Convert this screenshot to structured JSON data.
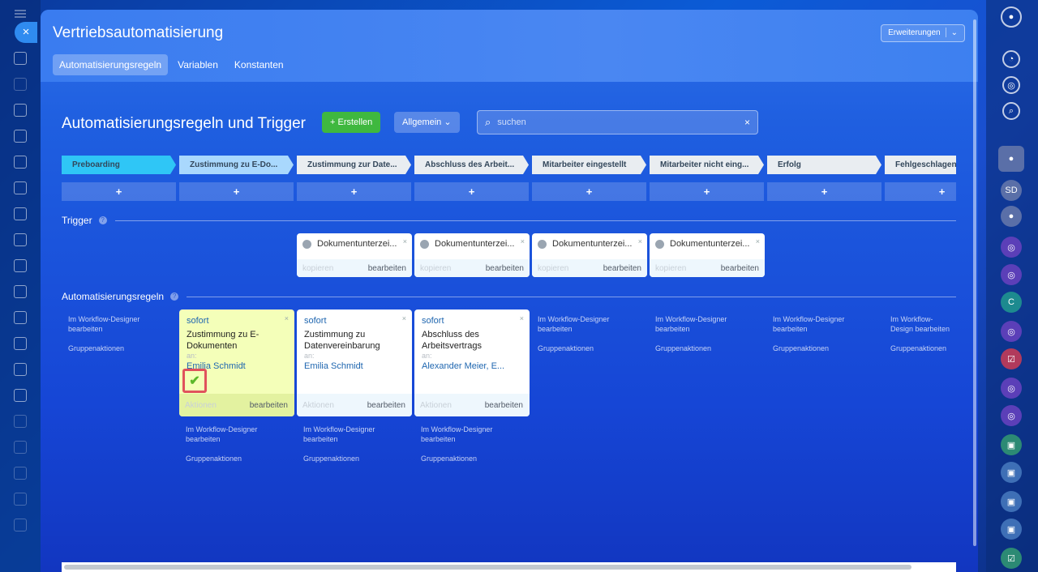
{
  "panel": {
    "title": "Vertriebsautomatisierung",
    "extensions_label": "Erweiterungen",
    "tabs": [
      {
        "label": "Automatisierungsregeln",
        "active": true
      },
      {
        "label": "Variablen",
        "active": false
      },
      {
        "label": "Konstanten",
        "active": false
      }
    ]
  },
  "toolbar": {
    "section_title": "Automatisierungsregeln und Trigger",
    "create_label": "+ Erstellen",
    "general_label": "Allgemein ⌄",
    "search_placeholder": "suchen"
  },
  "stages": [
    {
      "label": "Preboarding",
      "color": "#2fc6f6"
    },
    {
      "label": "Zustimmung zu E-Do...",
      "color": "#a9d8fd"
    },
    {
      "label": "Zustimmung zur Date...",
      "color": "#e9edf1"
    },
    {
      "label": "Abschluss des Arbeit...",
      "color": "#e9edf1"
    },
    {
      "label": "Mitarbeiter eingestellt",
      "color": "#e9edf1"
    },
    {
      "label": "Mitarbeiter nicht eing...",
      "color": "#e9edf1"
    },
    {
      "label": "Erfolg",
      "color": "#e9edf1"
    },
    {
      "label": "Fehlgeschlagen",
      "color": "#e9edf1"
    }
  ],
  "plus_label": "+",
  "trigger_section": {
    "label": "Trigger",
    "help": "?"
  },
  "rules_section": {
    "label": "Automatisierungsregeln",
    "help": "?"
  },
  "triggers": [
    {
      "name": "Dokumentunterzei...",
      "copy": "kopieren",
      "edit": "bearbeiten"
    },
    {
      "name": "Dokumentunterzei...",
      "copy": "kopieren",
      "edit": "bearbeiten"
    },
    {
      "name": "Dokumentunterzei...",
      "copy": "kopieren",
      "edit": "bearbeiten"
    },
    {
      "name": "Dokumentunterzei...",
      "copy": "kopieren",
      "edit": "bearbeiten"
    }
  ],
  "robots": [
    {
      "time": "sofort",
      "name": "Zustimmung zu E-Dokumenten",
      "an": "an:",
      "who": "Emilia Schmidt",
      "actions": "Aktionen",
      "edit": "bearbeiten"
    },
    {
      "time": "sofort",
      "name": "Zustimmung zu Datenvereinbarung",
      "an": "an:",
      "who": "Emilia Schmidt",
      "actions": "Aktionen",
      "edit": "bearbeiten"
    },
    {
      "time": "sofort",
      "name": "Abschluss des Arbeitsvertrags",
      "an": "an:",
      "who": "Alexander Meier, E...",
      "actions": "Aktionen",
      "edit": "bearbeiten"
    }
  ],
  "workflow_link": "Im Workflow-Designer bearbeiten",
  "workflow_link_clipped": "Im Workflow-Design bearbeiten",
  "group_actions": "Gruppenaktionen",
  "close_label": "×",
  "colors": {
    "accent": "#3fb83f",
    "highlight": "#f4ffb9",
    "link": "#2067b0"
  }
}
